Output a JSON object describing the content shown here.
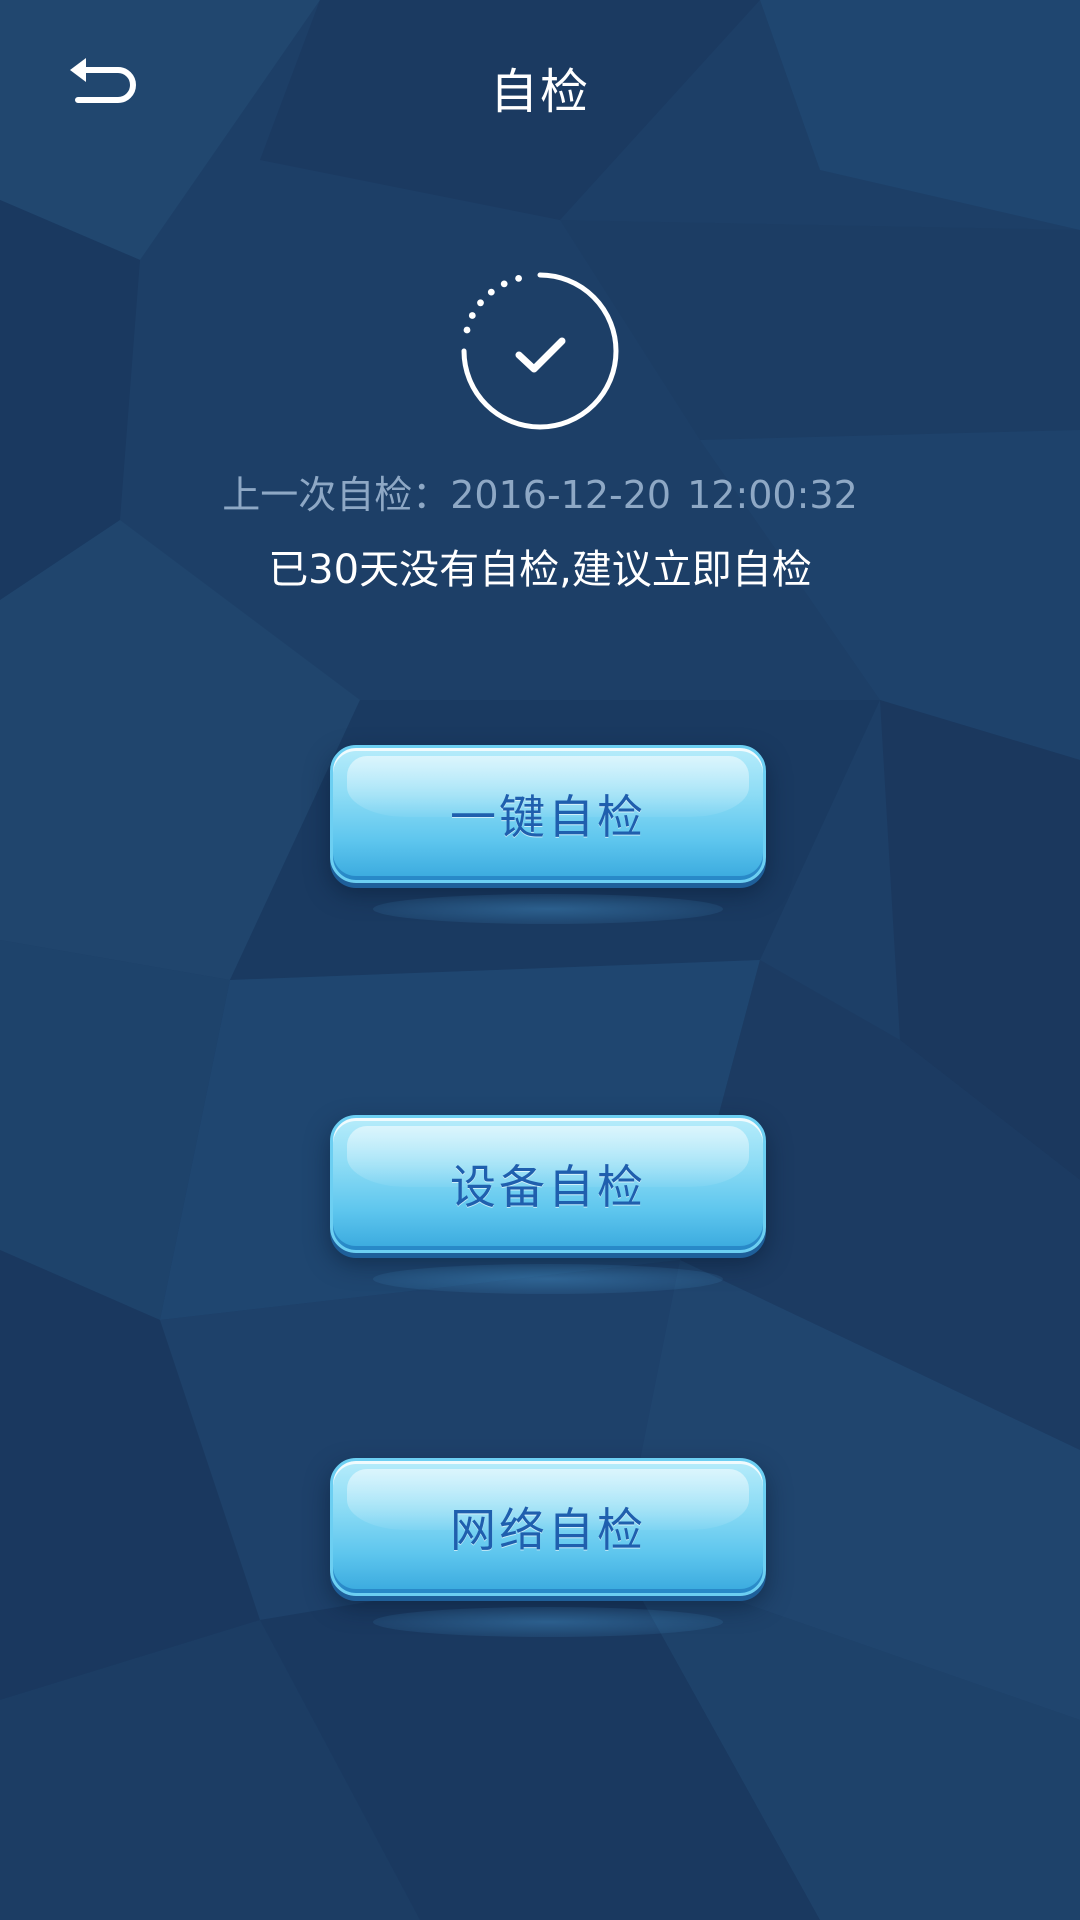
{
  "header": {
    "title": "自检",
    "back_icon": "back-arrow-icon"
  },
  "status": {
    "icon": "check-circle-icon",
    "last_check_label": "上一次自检：",
    "last_check_date": "2016-12-20",
    "last_check_time": "12:00:32",
    "advice": "已30天没有自检,建议立即自检"
  },
  "actions": [
    {
      "label": "一键自检"
    },
    {
      "label": "设备自检"
    },
    {
      "label": "网络自检"
    }
  ],
  "colors": {
    "background": "#1d3f67",
    "title_text": "#ffffff",
    "last_check_text": "#8ea8c5",
    "button_face": "#7fd6f4",
    "button_text": "#1f5fae"
  }
}
